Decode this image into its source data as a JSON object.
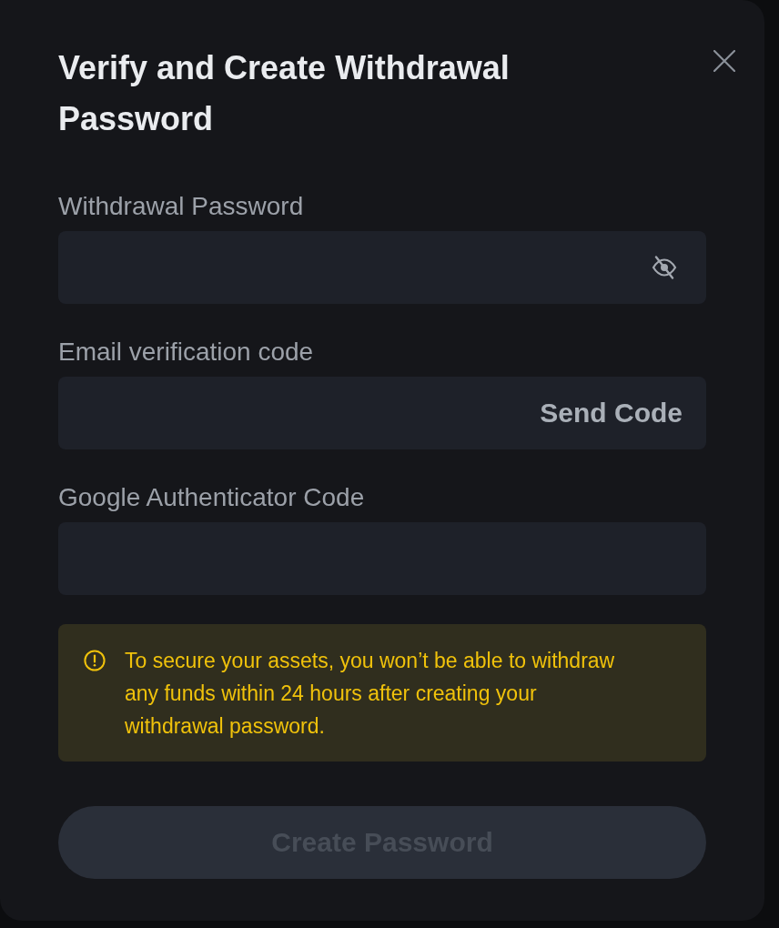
{
  "dialog": {
    "title": "Verify and Create Withdrawal Password"
  },
  "fields": [
    {
      "label": "Withdrawal Password",
      "kind": "password"
    },
    {
      "label": "Email verification code",
      "kind": "code",
      "action": "Send Code"
    },
    {
      "label": "Google Authenticator Code",
      "kind": "text"
    }
  ],
  "notice": {
    "text": "To secure your assets, you won’t be able to withdraw any funds within 24 hours after creating your withdrawal password."
  },
  "submit": {
    "label": "Create Password",
    "disabled": true
  }
}
